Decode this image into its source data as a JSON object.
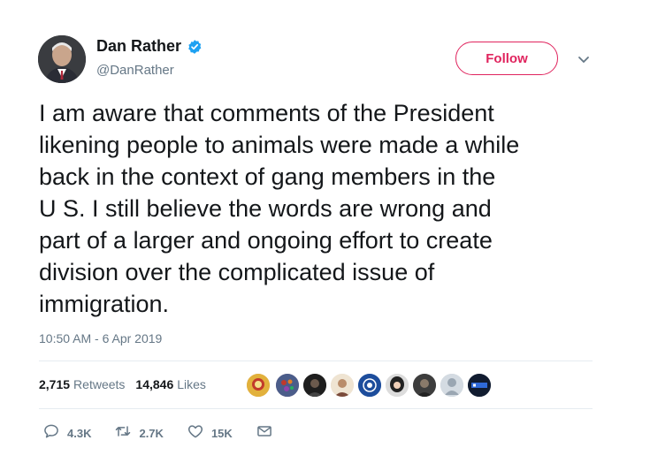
{
  "user": {
    "name": "Dan Rather",
    "handle": "@DanRather",
    "verified": true
  },
  "follow_label": "Follow",
  "tweet_lines": [
    "I am aware that comments of the President",
    "likening people to animals were made a while",
    "back in the context of gang members in the",
    "U S. I still believe the words are wrong and",
    "part of a larger and ongoing effort to create",
    "division over the complicated issue of",
    "immigration."
  ],
  "timestamp": "10:50 AM - 6 Apr 2019",
  "stats": {
    "retweets_count": "2,715",
    "retweets_label": "Retweets",
    "likes_count": "14,846",
    "likes_label": "Likes"
  },
  "likers_count_shown": 9,
  "actions": {
    "replies": "4.3K",
    "retweets": "2.7K",
    "likes": "15K"
  },
  "colors": {
    "follow_accent": "#e0245e",
    "verified_blue": "#1da1f2",
    "secondary_text": "#657786"
  },
  "icons": [
    "verified-badge-icon",
    "chevron-down-icon",
    "reply-icon",
    "retweet-icon",
    "like-icon",
    "message-icon"
  ]
}
